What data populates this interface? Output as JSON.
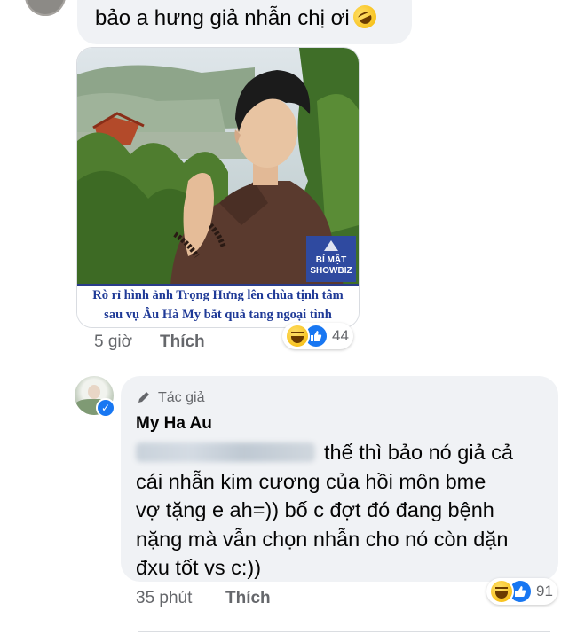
{
  "top_comment": {
    "text": "bảo a hưng giả nhẫn chị ơi",
    "emoji": "rolling-on-floor-laughing"
  },
  "photo_post": {
    "caption_line1": "Rò rỉ hình ảnh Trọng Hưng lên chùa tịnh tâm",
    "caption_line2": "sau vụ Âu Hà My bắt quả tang ngoại tình",
    "watermark_line1": "BÍ MẬT",
    "watermark_line2": "SHOWBIZ",
    "time": "5 giờ",
    "like_label": "Thích",
    "reaction_count": "44"
  },
  "reply": {
    "author_tag": "Tác giả",
    "author_name": "My Ha Au",
    "line1": "thế thì bảo nó giả cả",
    "line2": "cái nhẫn kim cương của hồi môn bme",
    "line3": "vợ tặng e ah=)) bố c đợt đó đang bệnh",
    "line4": "nặng mà vẫn chọn nhẫn cho nó còn dặn",
    "line5": "đxu tốt vs c:))",
    "time": "35 phút",
    "like_label": "Thích",
    "reaction_count": "91"
  },
  "icons": [
    "rofl-emoji",
    "haha-reaction-icon",
    "like-reaction-icon",
    "pencil-icon",
    "verified-badge-icon"
  ],
  "colors": {
    "bubble": "#f0f2f5",
    "meta": "#65676b",
    "like_blue": "#1877f2",
    "caption_blue": "#1f3a97"
  }
}
